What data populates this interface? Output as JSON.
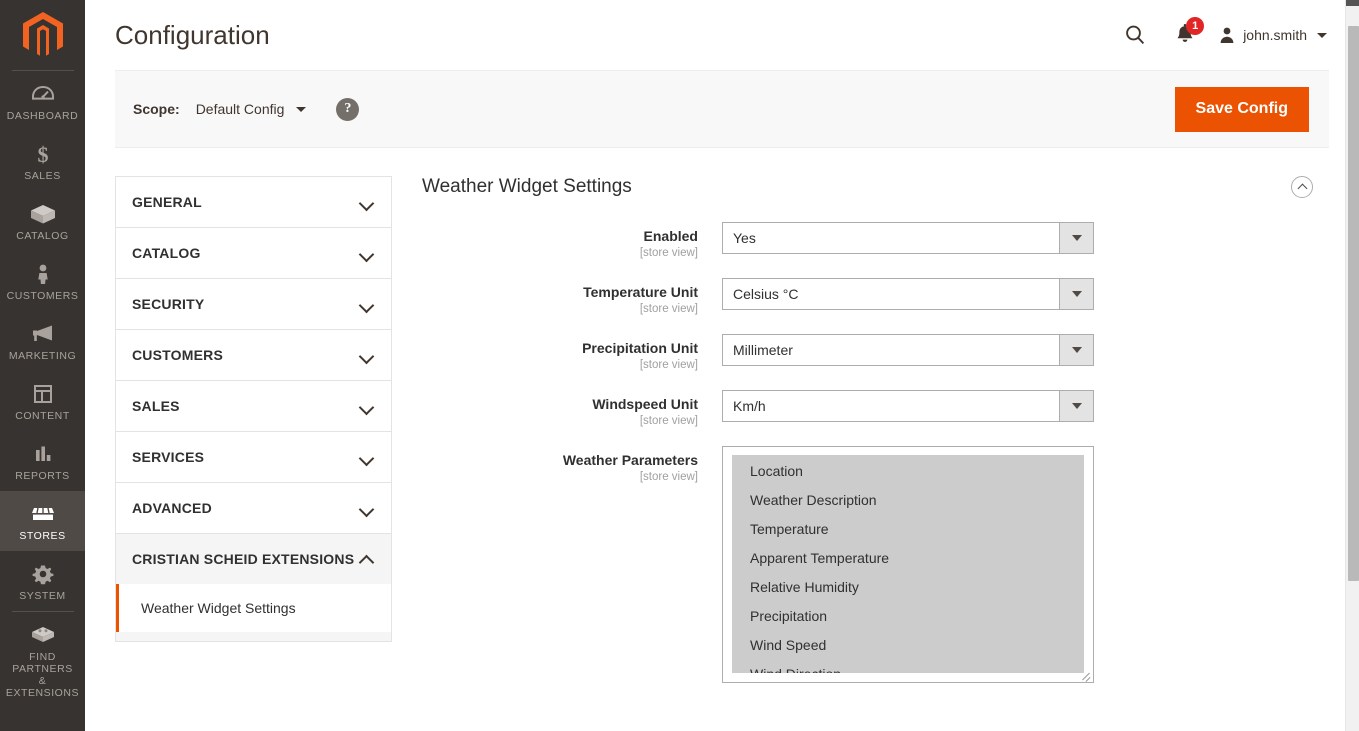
{
  "admin_nav": {
    "logo_name": "magento-logo",
    "items": [
      {
        "label": "DASHBOARD",
        "icon": "dashboard-icon",
        "active": false
      },
      {
        "label": "SALES",
        "icon": "dollar-icon",
        "active": false
      },
      {
        "label": "CATALOG",
        "icon": "box-icon",
        "active": false
      },
      {
        "label": "CUSTOMERS",
        "icon": "person-icon",
        "active": false
      },
      {
        "label": "MARKETING",
        "icon": "megaphone-icon",
        "active": false
      },
      {
        "label": "CONTENT",
        "icon": "layout-icon",
        "active": false
      },
      {
        "label": "REPORTS",
        "icon": "bar-chart-icon",
        "active": false
      },
      {
        "label": "STORES",
        "icon": "storefront-icon",
        "active": true
      },
      {
        "label": "SYSTEM",
        "icon": "gear-icon",
        "active": false
      },
      {
        "label": "FIND PARTNERS\n& EXTENSIONS",
        "icon": "blocks-icon",
        "active": false
      }
    ]
  },
  "header": {
    "title": "Configuration",
    "search_icon": "search-icon",
    "notifications_icon": "bell-icon",
    "notifications_count": "1",
    "user_icon": "user-avatar-icon",
    "user_name": "john.smith"
  },
  "page_actions": {
    "scope_label": "Scope:",
    "scope_value": "Default Config",
    "help_glyph": "?",
    "save_label": "Save Config"
  },
  "config_nav": {
    "sections": [
      {
        "label": "GENERAL",
        "expanded": false
      },
      {
        "label": "CATALOG",
        "expanded": false
      },
      {
        "label": "SECURITY",
        "expanded": false
      },
      {
        "label": "CUSTOMERS",
        "expanded": false
      },
      {
        "label": "SALES",
        "expanded": false
      },
      {
        "label": "SERVICES",
        "expanded": false
      },
      {
        "label": "ADVANCED",
        "expanded": false
      },
      {
        "label": "CRISTIAN SCHEID EXTENSIONS",
        "expanded": true
      }
    ],
    "current_subitem": "Weather Widget Settings"
  },
  "section": {
    "title": "Weather Widget Settings",
    "collapse_icon": "chevron-up-circle-icon",
    "scope_note": "[store view]",
    "fields": [
      {
        "label": "Enabled",
        "scope": "[store view]",
        "type": "select",
        "value": "Yes"
      },
      {
        "label": "Temperature Unit",
        "scope": "[store view]",
        "type": "select",
        "value": "Celsius °C"
      },
      {
        "label": "Precipitation Unit",
        "scope": "[store view]",
        "type": "select",
        "value": "Millimeter"
      },
      {
        "label": "Windspeed Unit",
        "scope": "[store view]",
        "type": "select",
        "value": "Km/h"
      }
    ],
    "multiselect": {
      "label": "Weather Parameters",
      "scope": "[store view]",
      "options": [
        "Location",
        "Weather Description",
        "Temperature",
        "Apparent Temperature",
        "Relative Humidity",
        "Precipitation",
        "Wind Speed",
        "Wind Direction"
      ]
    }
  },
  "colors": {
    "brand_orange": "#eb5202",
    "nav_background": "#373330",
    "nav_active": "#4f4a46",
    "badge_red": "#e22626",
    "selected_option": "#cccccc",
    "text_dark": "#303030"
  }
}
